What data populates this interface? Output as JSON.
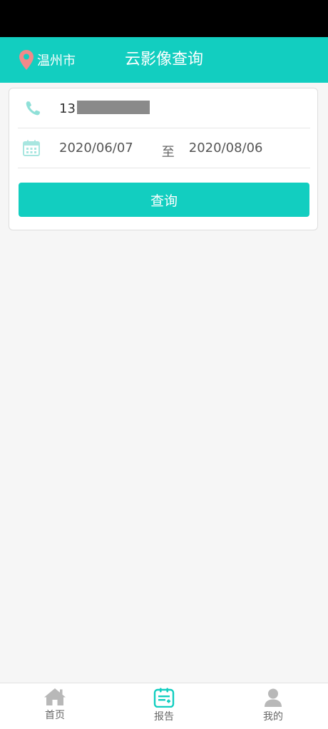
{
  "header": {
    "city": "温州市",
    "title": "云影像查询"
  },
  "query": {
    "phone_prefix": "13",
    "date_start": "2020/06/07",
    "date_separator": "至",
    "date_end": "2020/08/06",
    "button_label": "查询"
  },
  "tabs": [
    {
      "label": "首页",
      "icon": "home-icon"
    },
    {
      "label": "报告",
      "icon": "report-icon"
    },
    {
      "label": "我的",
      "icon": "user-icon"
    }
  ],
  "colors": {
    "accent": "#12cec0",
    "location_pin": "#f08a8a",
    "inactive_icon": "#b8b8b8"
  }
}
